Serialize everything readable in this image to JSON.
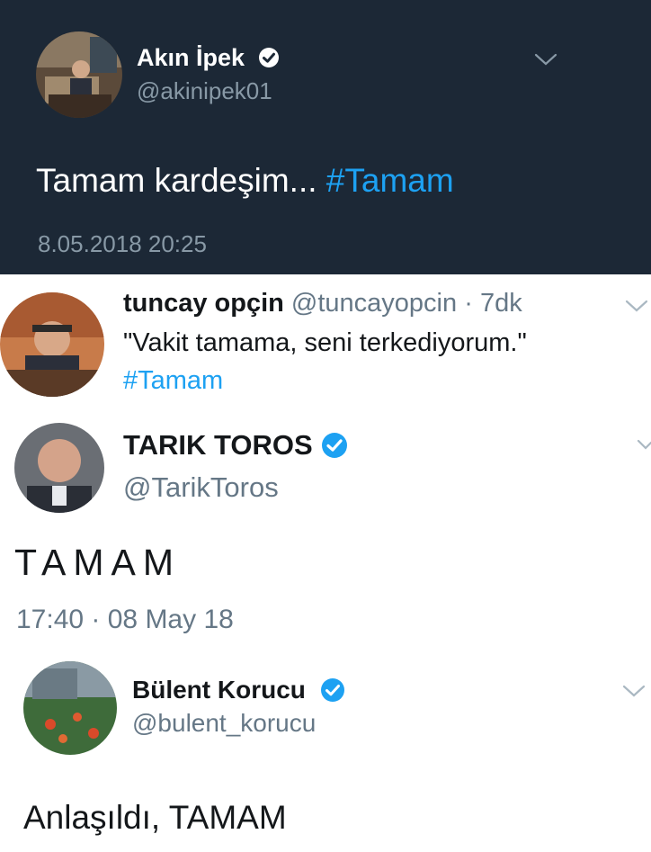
{
  "tweets": [
    {
      "display_name": "Akın İpek",
      "handle": "@akinipek01",
      "text": "Tamam kardeşim...",
      "hashtag": "#Tamam",
      "timestamp": "8.05.2018 20:25",
      "verified": true,
      "theme": "dark"
    },
    {
      "display_name": "tuncay opçin",
      "handle": "@tuncayopcin",
      "separator": "·",
      "age": "7dk",
      "text": "\"Vakit tamama, seni terkediyorum.\"",
      "hashtag": "#Tamam",
      "verified": false,
      "theme": "light"
    },
    {
      "display_name": "TARIK TOROS",
      "handle": "@TarikToros",
      "text": "TAMAM",
      "timestamp": "17:40 · 08 May 18",
      "verified": true,
      "theme": "light"
    },
    {
      "display_name": "Bülent Korucu",
      "handle": "@bulent_korucu",
      "text": "Anlaşıldı, TAMAM",
      "verified": true,
      "theme": "light"
    }
  ],
  "icons": {
    "verified": "verified-badge-icon",
    "menu": "chevron-down-icon"
  },
  "colors": {
    "dark_bg": "#1c2836",
    "link_blue": "#1da1f2",
    "verified_blue": "#1da1f2",
    "muted_dark": "#8899a6",
    "muted_light": "#657786"
  }
}
